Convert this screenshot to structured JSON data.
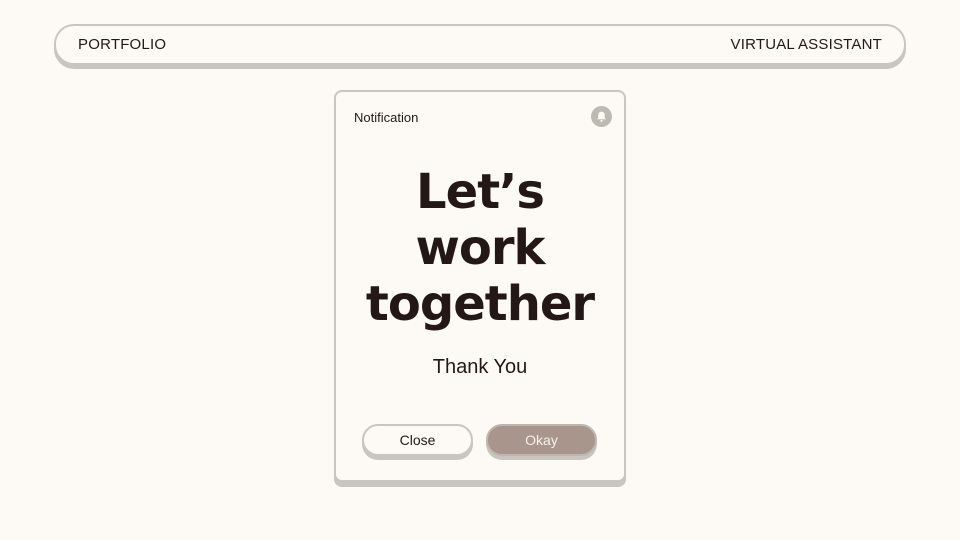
{
  "header": {
    "left_label": "PORTFOLIO",
    "right_label": "VIRTUAL ASSISTANT"
  },
  "notification": {
    "title": "Notification",
    "icon": "bell-icon",
    "headline_lines": [
      "Let’s",
      "work",
      "together"
    ],
    "subtext": "Thank You",
    "close_label": "Close",
    "okay_label": "Okay"
  },
  "colors": {
    "background": "#fdfaf5",
    "border": "#c9c6c1",
    "text": "#231815",
    "accent_button": "#a8958c"
  }
}
